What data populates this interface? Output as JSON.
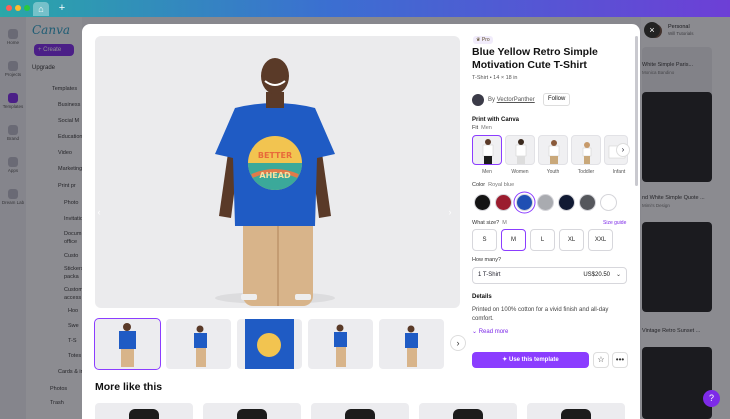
{
  "browser": {
    "home_icon": "home-icon",
    "new_tab_icon": "plus-icon",
    "new_tab_glyph": "+"
  },
  "background": {
    "logo": "Canva",
    "create_label": "+ Create",
    "upgrade_label": "Upgrade",
    "rail": [
      "Home",
      "Projects",
      "Templates",
      "Brand",
      "Apps",
      "Dream Lab"
    ],
    "tree": [
      "Templates",
      "Business",
      "Social M",
      "Education",
      "Video",
      "Marketing",
      "Print pr",
      "Photo",
      "Invitations",
      "Docum",
      "office",
      "Custo",
      "Stickers",
      "packa",
      "Custom",
      "access",
      "Hoo",
      "Swe",
      "T-S",
      "Totes",
      "Cards & inv",
      "Photos",
      "Trash"
    ],
    "user": {
      "name": "Personal",
      "plan": "Will Tutorials"
    },
    "cards": [
      {
        "title": "White Simple Paris...",
        "sub": "Monica Bandino"
      },
      {
        "title": "nd White Simple Quote ...",
        "sub": "Mimi's Design"
      },
      {
        "title": "Vintage Retro Sunset ...",
        "sub": ""
      }
    ]
  },
  "modal": {
    "close_glyph": "×",
    "pro_badge": "Pro",
    "title": "Blue Yellow Retro Simple Motivation Cute T-Shirt",
    "subtitle": "T-Shirt • 14 × 18 in",
    "author_prefix": "By",
    "author_name": "VectorPanther",
    "follow_label": "Follow",
    "print_heading": "Print with Canva",
    "fit_label": "Fit",
    "fit_value": "Men",
    "fits": [
      "Men",
      "Women",
      "Youth",
      "Toddler",
      "Infant"
    ],
    "color_label": "Color",
    "color_value": "Royal blue",
    "swatches": [
      "#141414",
      "#9b1c2e",
      "#1f4fb3",
      "#a9abb0",
      "#111a33",
      "#55575c",
      "#ffffff"
    ],
    "size_label": "What size?",
    "size_value": "M",
    "size_guide": "Size guide",
    "sizes": [
      "S",
      "M",
      "L",
      "XL",
      "XXL"
    ],
    "qty_label": "How many?",
    "qty_value": "1 T-Shirt",
    "qty_price": "US$20.50",
    "details_heading": "Details",
    "details_text": "Printed on 100% cotton for a vivid finish and all-day comfort.",
    "read_more": "Read more",
    "cta_label": "Use this template",
    "more_title": "More like this",
    "shirt_text_top": "BETTER",
    "shirt_text_bottom": "AHEAD",
    "accent": "#8b3dff",
    "shirt_color": "#1f5bc4"
  }
}
